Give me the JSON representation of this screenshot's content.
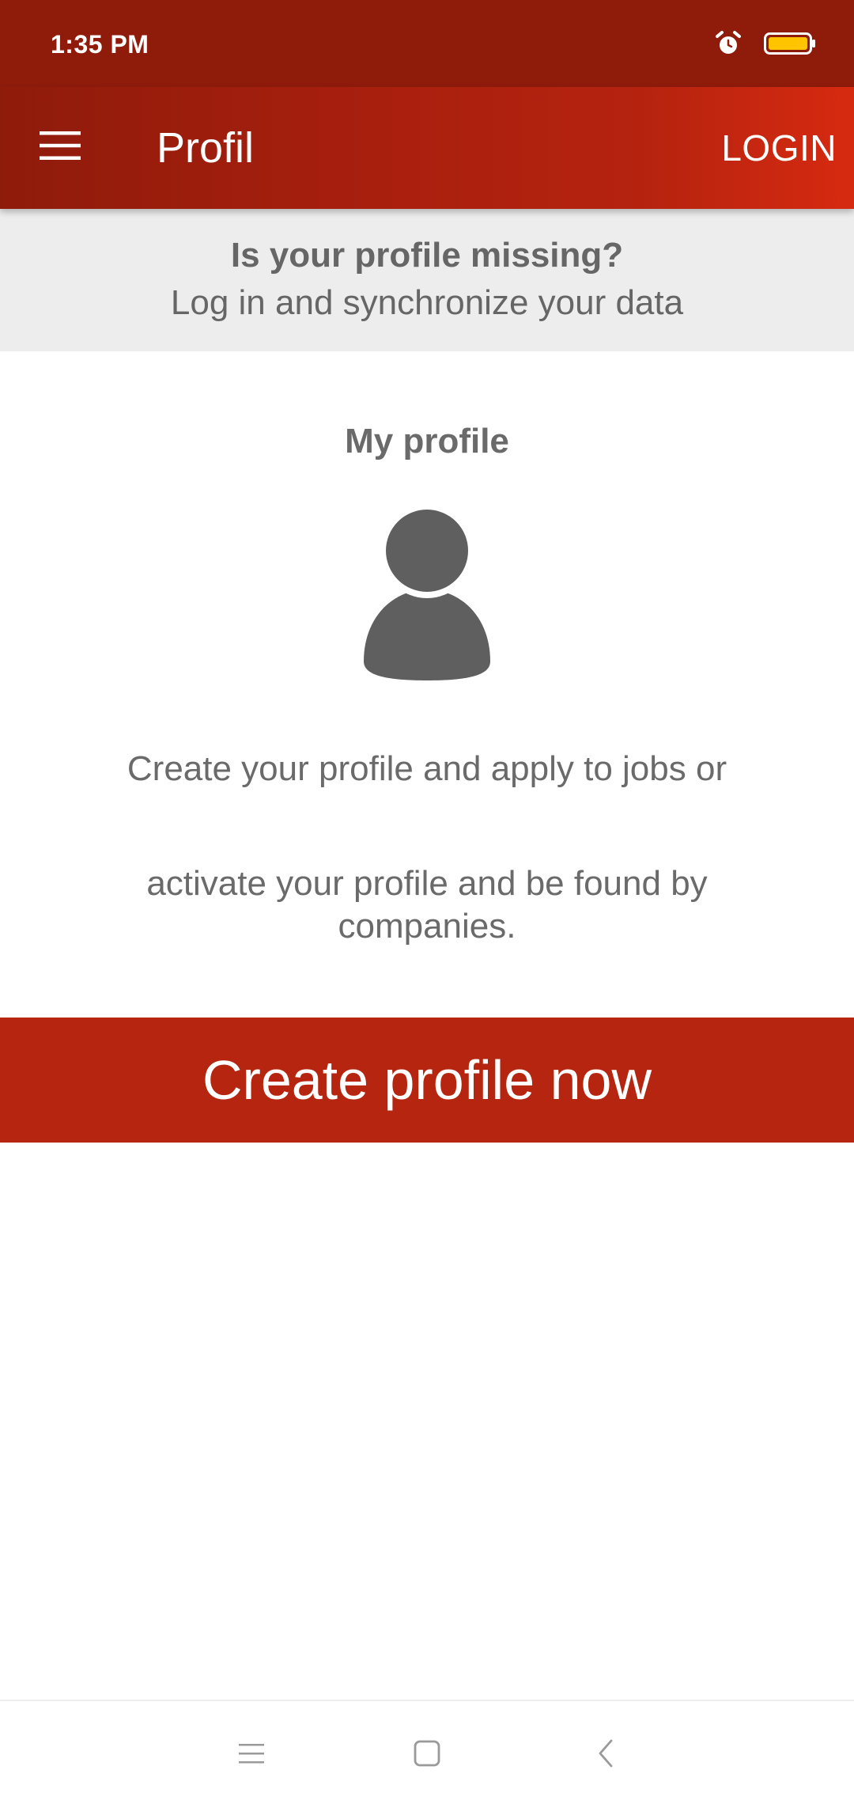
{
  "status_bar": {
    "time": "1:35 PM",
    "icons": [
      "alarm-icon",
      "battery-icon"
    ],
    "battery_color": "#ffc400"
  },
  "app_bar": {
    "title": "Profil",
    "login_label": "LOGIN",
    "menu_icon": "hamburger-menu-icon"
  },
  "banner": {
    "title": "Is your profile missing?",
    "subtitle": "Log in and synchronize your data"
  },
  "profile": {
    "heading": "My profile",
    "avatar_icon": "person-icon",
    "description_line_1": "Create your profile and apply to jobs or",
    "description_line_2": "activate your profile and be found by companies."
  },
  "cta": {
    "label": "Create profile now"
  },
  "nav_bar": {
    "icons": [
      "recents-icon",
      "home-icon",
      "back-icon"
    ]
  },
  "colors": {
    "primary": "#b5250f",
    "primary_dark": "#8f1b0b",
    "text_gray": "#6a6a6a",
    "banner_bg": "#ededed"
  }
}
